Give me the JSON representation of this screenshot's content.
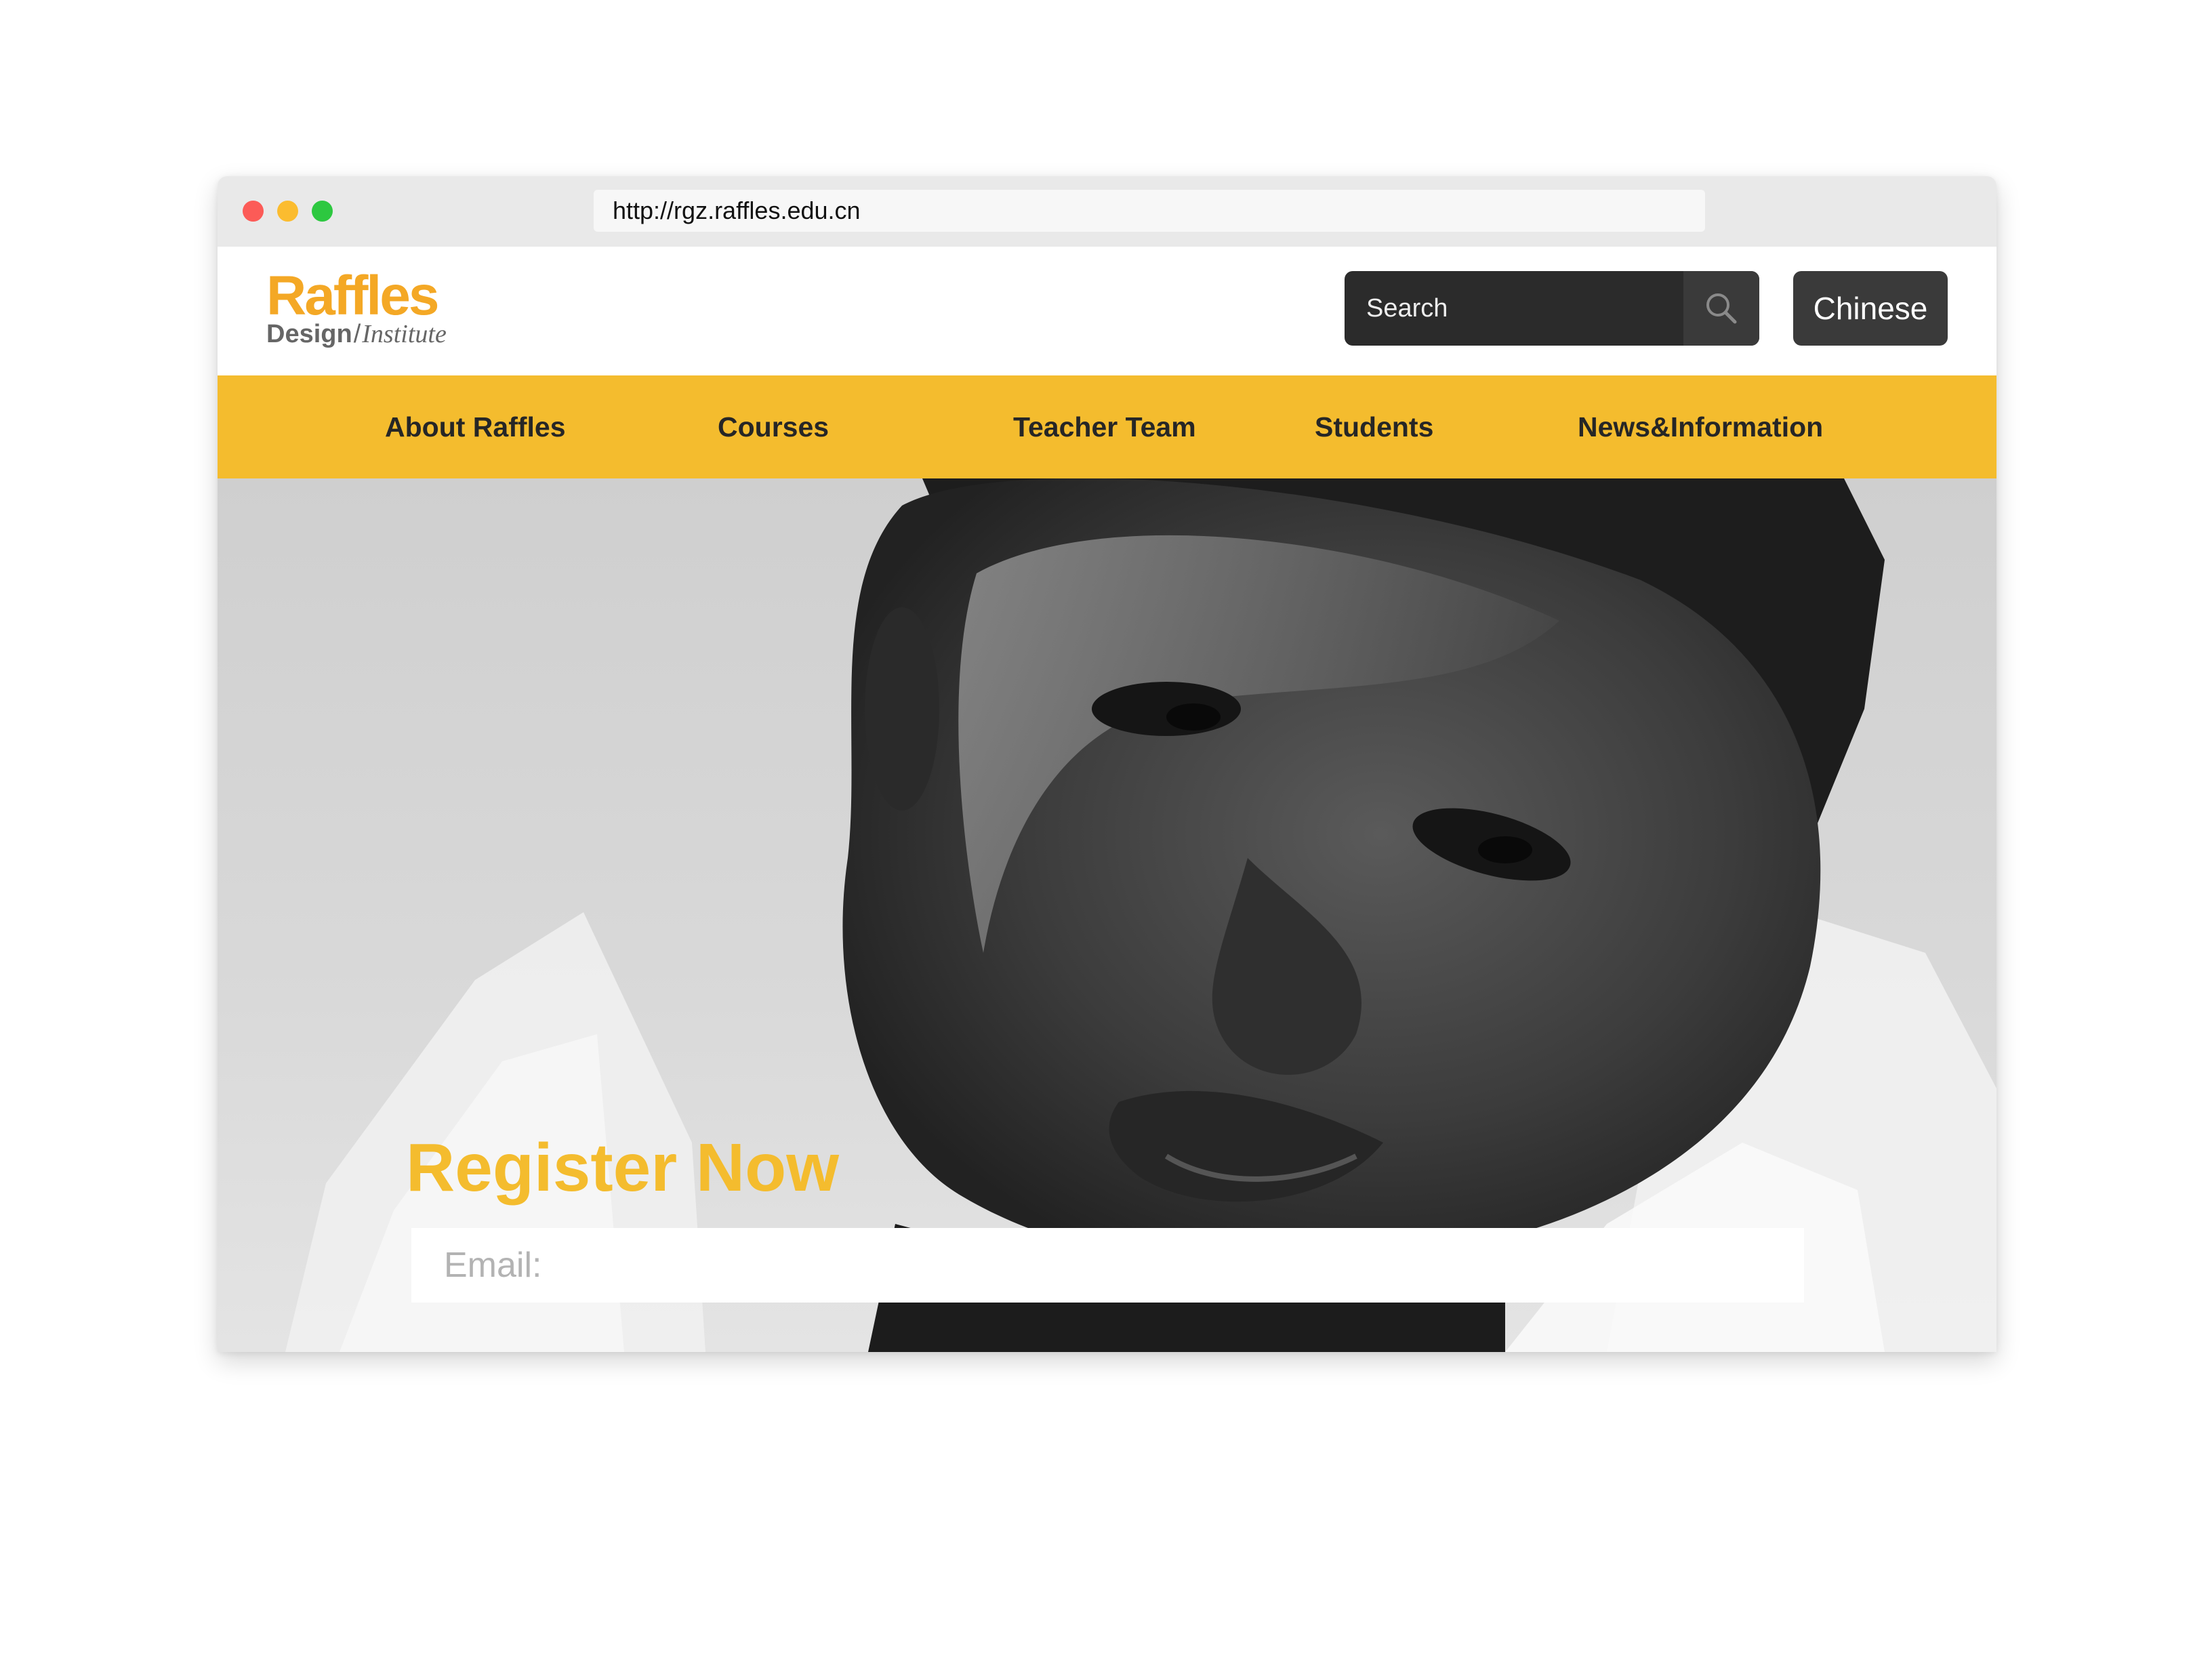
{
  "browser": {
    "url": "http://rgz.raffles.edu.cn"
  },
  "logo": {
    "main": "Raffles",
    "design": "Design",
    "slash": "/",
    "institute": "Institute"
  },
  "search": {
    "placeholder": "Search",
    "icon": "search-icon"
  },
  "language_button": "Chinese",
  "nav": {
    "items": [
      {
        "label": "About Raffles"
      },
      {
        "label": "Courses"
      },
      {
        "label": "Teacher Team"
      },
      {
        "label": "Students"
      },
      {
        "label": "News&Information"
      }
    ]
  },
  "hero": {
    "headline": "Register Now",
    "email_placeholder": "Email:"
  },
  "colors": {
    "brand_yellow": "#f4bc2e",
    "logo_orange": "#f4a825",
    "dark_button": "#3a3a3a"
  }
}
